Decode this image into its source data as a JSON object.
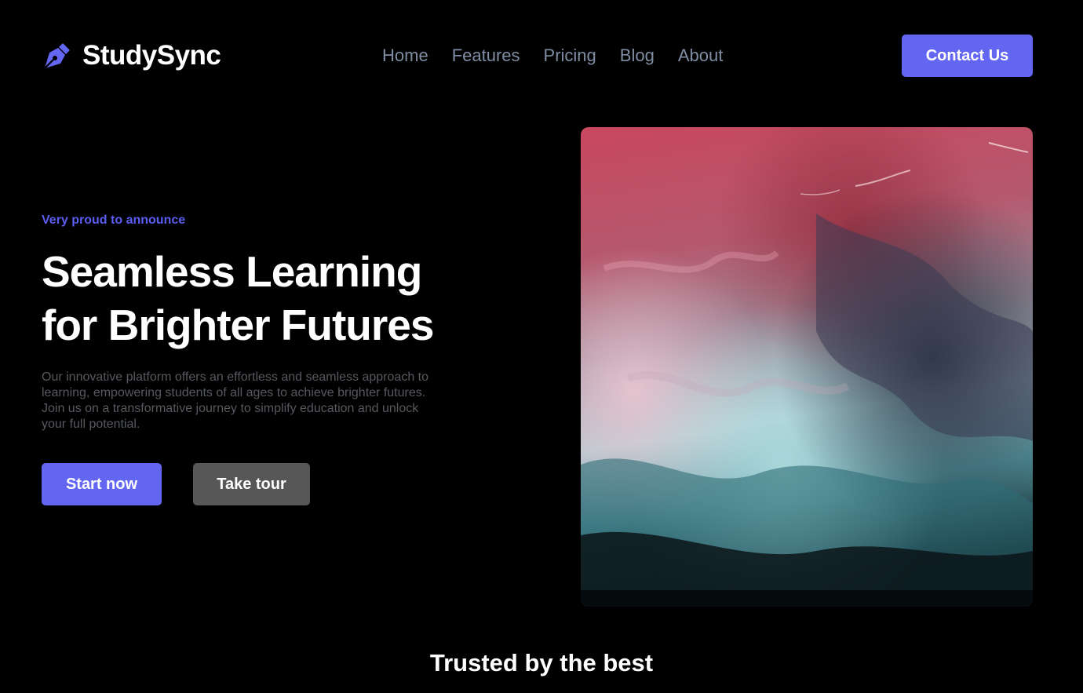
{
  "header": {
    "brand_name": "StudySync",
    "brand_icon": "pen-nib-icon",
    "nav": [
      {
        "label": "Home"
      },
      {
        "label": "Features"
      },
      {
        "label": "Pricing"
      },
      {
        "label": "Blog"
      },
      {
        "label": "About"
      }
    ],
    "contact_label": "Contact Us"
  },
  "hero": {
    "eyebrow": "Very proud to announce",
    "headline_line1": "Seamless Learning",
    "headline_line2": "for Brighter Futures",
    "description": "Our innovative platform offers an effortless and seamless approach to learning, empowering students of all ages to achieve brighter futures. Join us on a transformative journey to simplify education and unlock your full potential.",
    "primary_cta": "Start now",
    "secondary_cta": "Take tour",
    "image_alt": "abstract-fluid-art"
  },
  "trusted": {
    "title": "Trusted by the best"
  },
  "colors": {
    "background": "#000000",
    "accent": "#6366f1",
    "nav_text": "#7f8da3",
    "muted_text": "#56595f",
    "secondary_button": "#575757"
  }
}
